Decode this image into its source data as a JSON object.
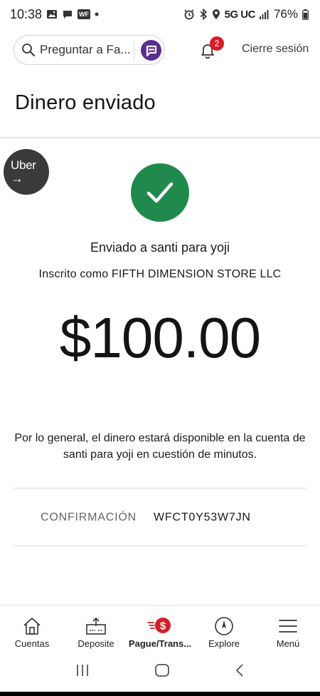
{
  "status_bar": {
    "time": "10:38",
    "badge": "WF",
    "network": "5G UC",
    "battery": "76%"
  },
  "header": {
    "search_placeholder": "Preguntar a Fa...",
    "notification_count": "2",
    "logout_label": "Cierre sesión"
  },
  "page": {
    "title": "Dinero enviado"
  },
  "uber": {
    "label": "Uber",
    "arrow": "→"
  },
  "result": {
    "sent_to": "Enviado a santi para yoji",
    "registered_as": "Inscrito como FIFTH DIMENSION STORE LLC",
    "amount": "$100.00",
    "availability": "Por lo general, el dinero estará disponible en la cuenta de santi para yoji en cuestión de minutos.",
    "confirmation_label": "CONFIRMACIÓN",
    "confirmation_value": "WFCT0Y53W7JN"
  },
  "bottom_nav": {
    "items": [
      {
        "label": "Cuentas",
        "icon": "house-icon"
      },
      {
        "label": "Deposite",
        "icon": "deposit-icon"
      },
      {
        "label": "Pague/Trans...",
        "icon": "pay-transfer-icon",
        "active": true
      },
      {
        "label": "Explore",
        "icon": "compass-icon"
      },
      {
        "label": "Menú",
        "icon": "hamburger-icon"
      }
    ]
  },
  "colors": {
    "success_green": "#1f8a4c",
    "brand_red": "#d71e28",
    "fargo_purple": "#5a2d91"
  }
}
